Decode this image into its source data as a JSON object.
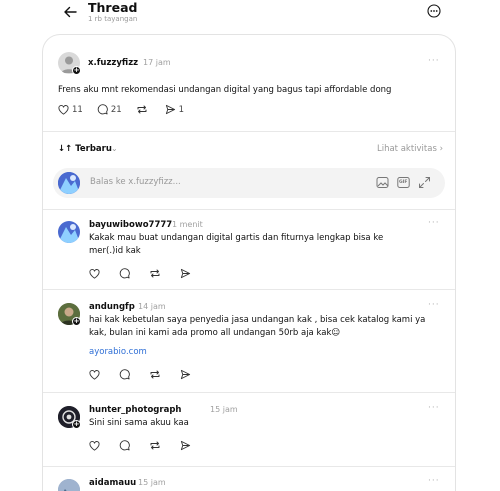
{
  "header": {
    "title": "Thread",
    "subtitle": "1 rb tayangan"
  },
  "post": {
    "username": "x.fuzzyfizz",
    "time": "17 jam",
    "text": "Frens aku mnt rekomendasi undangan digital yang bagus tapi affordable dong",
    "likes": "11",
    "comments": "21",
    "shares": "1"
  },
  "sort": {
    "label": "Terbaru",
    "activity": "Lihat aktivitas"
  },
  "reply": {
    "placeholder": "Balas ke x.fuzzyfizz...",
    "gif_label": "GIF"
  },
  "comments": [
    {
      "username": "bayuwibowo7777",
      "time": "1 menit",
      "lines": [
        "Kakak mau buat undangan digital gartis dan fiturnya lengkap bisa ke",
        "mer(.)id kak"
      ]
    },
    {
      "username": "andungfp",
      "time": "14 jam",
      "lines": [
        "hai kak kebetulan saya penyedia jasa undangan kak , bisa cek katalog kami ya",
        "kak, bulan ini kami ada promo all undangan 50rb aja kak☺"
      ],
      "link": "ayorabio.com"
    },
    {
      "username": "hunter_photograph",
      "time": "15 jam",
      "lines": [
        "Sini sini sama akuu kaa"
      ]
    },
    {
      "username": "aidamauu",
      "time": "15 jam",
      "lines": []
    }
  ],
  "icons": {
    "back": "arrow-left-icon",
    "menu": "more-circle-icon",
    "like": "heart-icon",
    "comment": "comment-bubble-icon",
    "repost": "repost-icon",
    "share": "send-icon",
    "image": "image-icon",
    "gif": "gif-icon",
    "expand": "expand-icon"
  },
  "colors": {
    "link": "#2f6fd6",
    "muted": "#999999"
  }
}
